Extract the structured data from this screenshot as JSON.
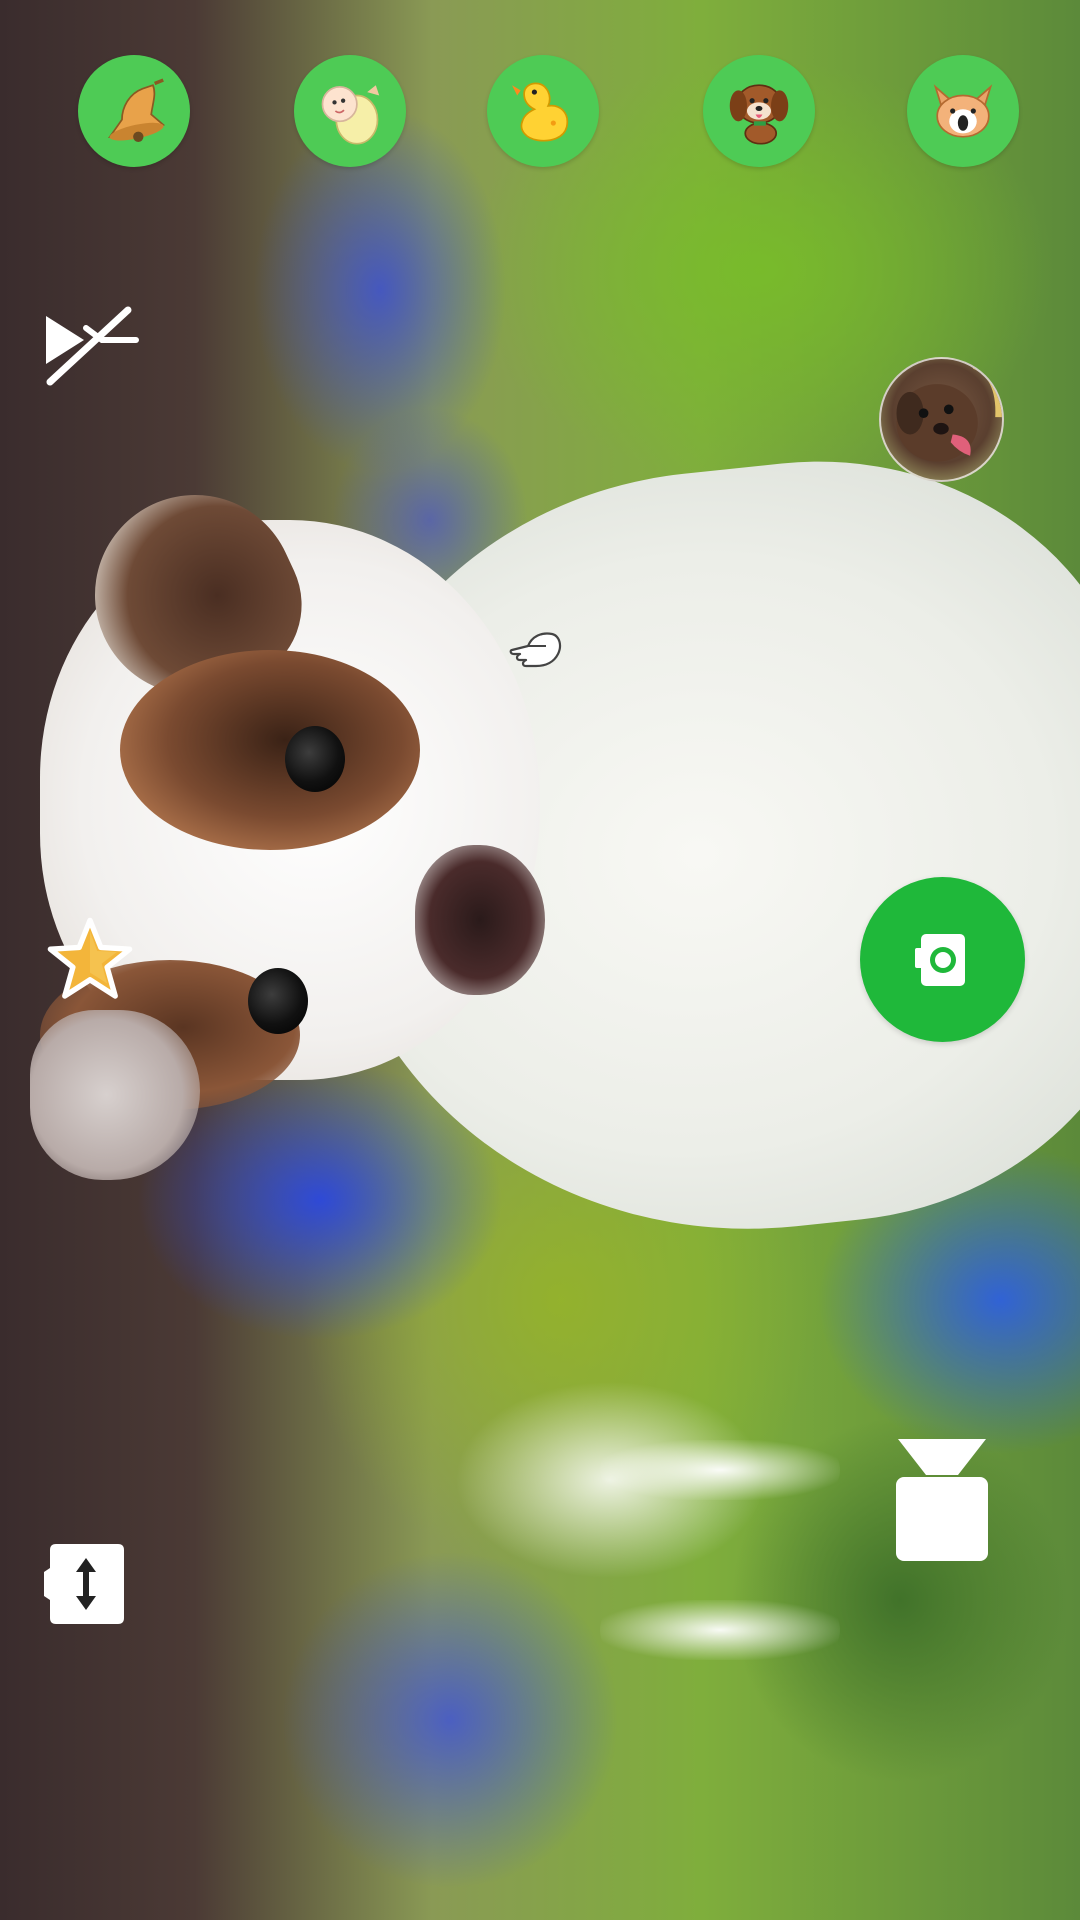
{
  "screen": {
    "type": "camera-viewfinder",
    "subject": ""
  },
  "sound_buttons": [
    {
      "icon": "bell-icon",
      "color": "#4ecb55"
    },
    {
      "icon": "baby-icon",
      "color": "#4ecb55"
    },
    {
      "icon": "rubber-duck-icon",
      "color": "#4ecb55"
    },
    {
      "icon": "puppy-icon",
      "color": "#4ecb55"
    },
    {
      "icon": "corgi-icon",
      "color": "#4ecb55"
    }
  ],
  "controls": {
    "mute_icon": "volume-off-icon",
    "avatar_icon": "dog-photo-thumbnail",
    "hand_icon": "pointing-hand-icon",
    "favorite_icon": "star-icon",
    "shutter_icon": "camera-icon",
    "flip_icon": "flip-camera-icon",
    "flash_icon": "flashlight-icon"
  },
  "colors": {
    "accent_green": "#4ecb55",
    "shutter_green": "#1fb83a",
    "icon_white": "#ffffff"
  }
}
